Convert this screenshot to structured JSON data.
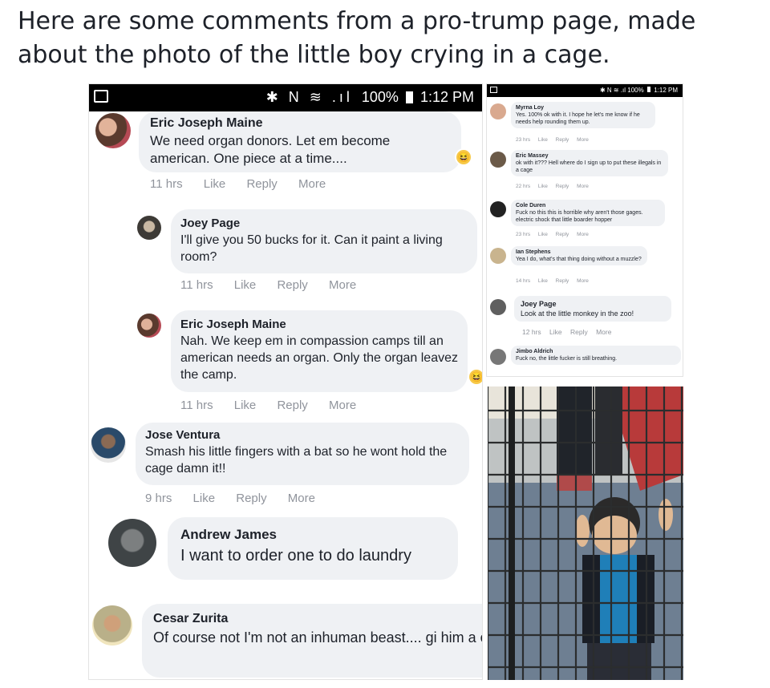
{
  "post": {
    "caption": "Here are some comments from a pro-trump page, made about the photo of the little boy crying in a cage."
  },
  "left_shot": {
    "status": {
      "icons": "✱ N ≋ .ıl",
      "battery": "100%",
      "time": "1:12 PM"
    },
    "comments": [
      {
        "name": "Eric Joseph Maine",
        "text": "We need organ donors. Let em become american. One piece at a time....",
        "time": "11 hrs",
        "like": "Like",
        "reply": "Reply",
        "more": "More"
      },
      {
        "name": "Joey Page",
        "text": "I'll give you 50 bucks for it. Can it paint a living room?",
        "time": "11 hrs",
        "like": "Like",
        "reply": "Reply",
        "more": "More"
      },
      {
        "name": "Eric Joseph Maine",
        "text": "Nah. We keep em in compassion camps till an american needs an organ. Only the organ leavez the camp.",
        "time": "11 hrs",
        "like": "Like",
        "reply": "Reply",
        "more": "More"
      },
      {
        "name": "Jose Ventura",
        "text": "Smash his little fingers with a bat so he wont hold the cage damn it!!",
        "time": "9 hrs",
        "like": "Like",
        "reply": "Reply",
        "more": "More"
      },
      {
        "name": "Andrew James",
        "text": "I want to order one to do laundry"
      },
      {
        "name": "Cesar Zurita",
        "text": "Of course not I'm not an inhuman beast.... gi him a churro and send him on his way"
      }
    ]
  },
  "right_shot": {
    "status": {
      "icons": "✱ N ≋ .ıl",
      "battery": "100%",
      "time": "1:12 PM"
    },
    "comments": [
      {
        "name": "Myrna Loy",
        "text": "Yes. 100% ok with it. I hope he let's me know if he needs help rounding them up.",
        "time": "23 hrs",
        "like": "Like",
        "reply": "Reply",
        "more": "More"
      },
      {
        "name": "Eric Massey",
        "text": "ok with it??? Hell where do I sign up to put these illegals in a cage",
        "time": "22 hrs",
        "like": "Like",
        "reply": "Reply",
        "more": "More"
      },
      {
        "name": "Cole Duren",
        "text": "Fuck no this this is horrible why aren't those gages. electric shock that little boarder hopper",
        "time": "23 hrs",
        "like": "Like",
        "reply": "Reply",
        "more": "More"
      },
      {
        "name": "Ian Stephens",
        "text": "Yea I do, what's that thing doing without a muzzle?",
        "time": "14 hrs",
        "like": "Like",
        "reply": "Reply",
        "more": "More"
      },
      {
        "name": "Joey Page",
        "text": "Look at the little monkey in the zoo!",
        "time": "12 hrs",
        "like": "Like",
        "reply": "Reply",
        "more": "More"
      },
      {
        "name": "Jimbo Aldrich",
        "text": "Fuck no, the little fucker is still breathing."
      }
    ]
  },
  "colors": {
    "bubble": "#eff1f4",
    "meta": "#90949c",
    "text": "#1d2129"
  }
}
